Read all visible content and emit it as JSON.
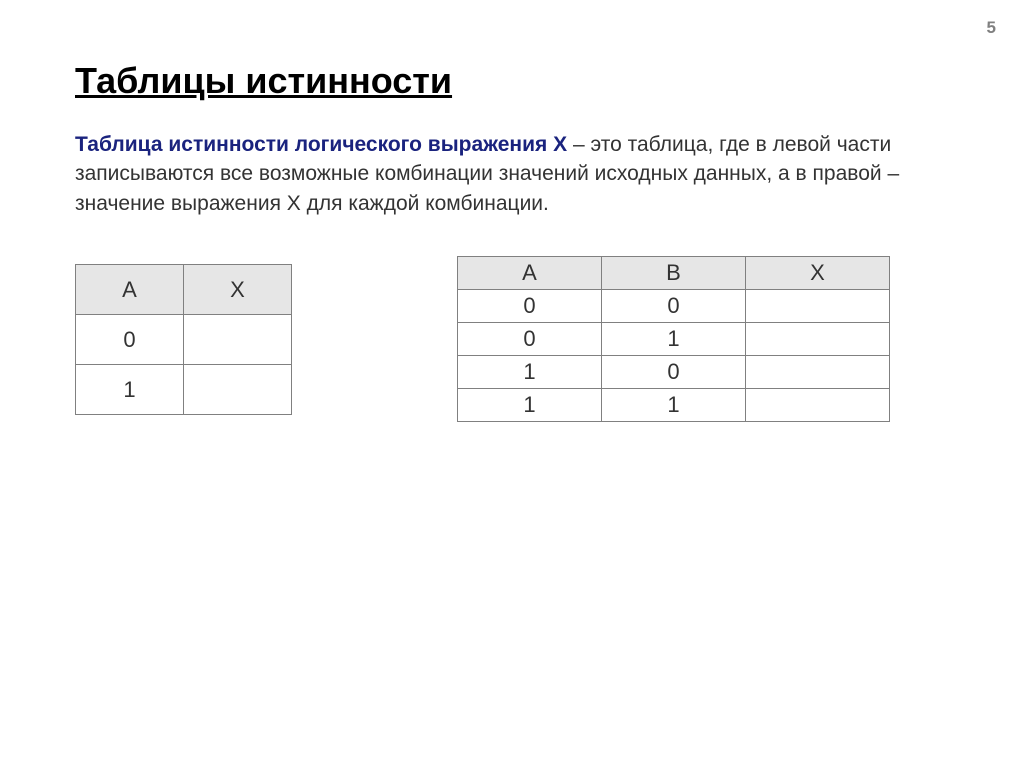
{
  "page_number": "5",
  "title": "Таблицы истинности",
  "definition": {
    "term": "Таблица истинности логического выражения Х",
    "text": " – это таблица, где в левой части записываются все возможные комбинации значений исходных данных, а в правой – значение выражения Х для каждой комбинации."
  },
  "table1": {
    "headers": [
      "A",
      "X"
    ],
    "rows": [
      [
        "0",
        ""
      ],
      [
        "1",
        ""
      ]
    ]
  },
  "table2": {
    "headers": [
      "A",
      "B",
      "X"
    ],
    "rows": [
      [
        "0",
        "0",
        ""
      ],
      [
        "0",
        "1",
        ""
      ],
      [
        "1",
        "0",
        ""
      ],
      [
        "1",
        "1",
        ""
      ]
    ]
  }
}
